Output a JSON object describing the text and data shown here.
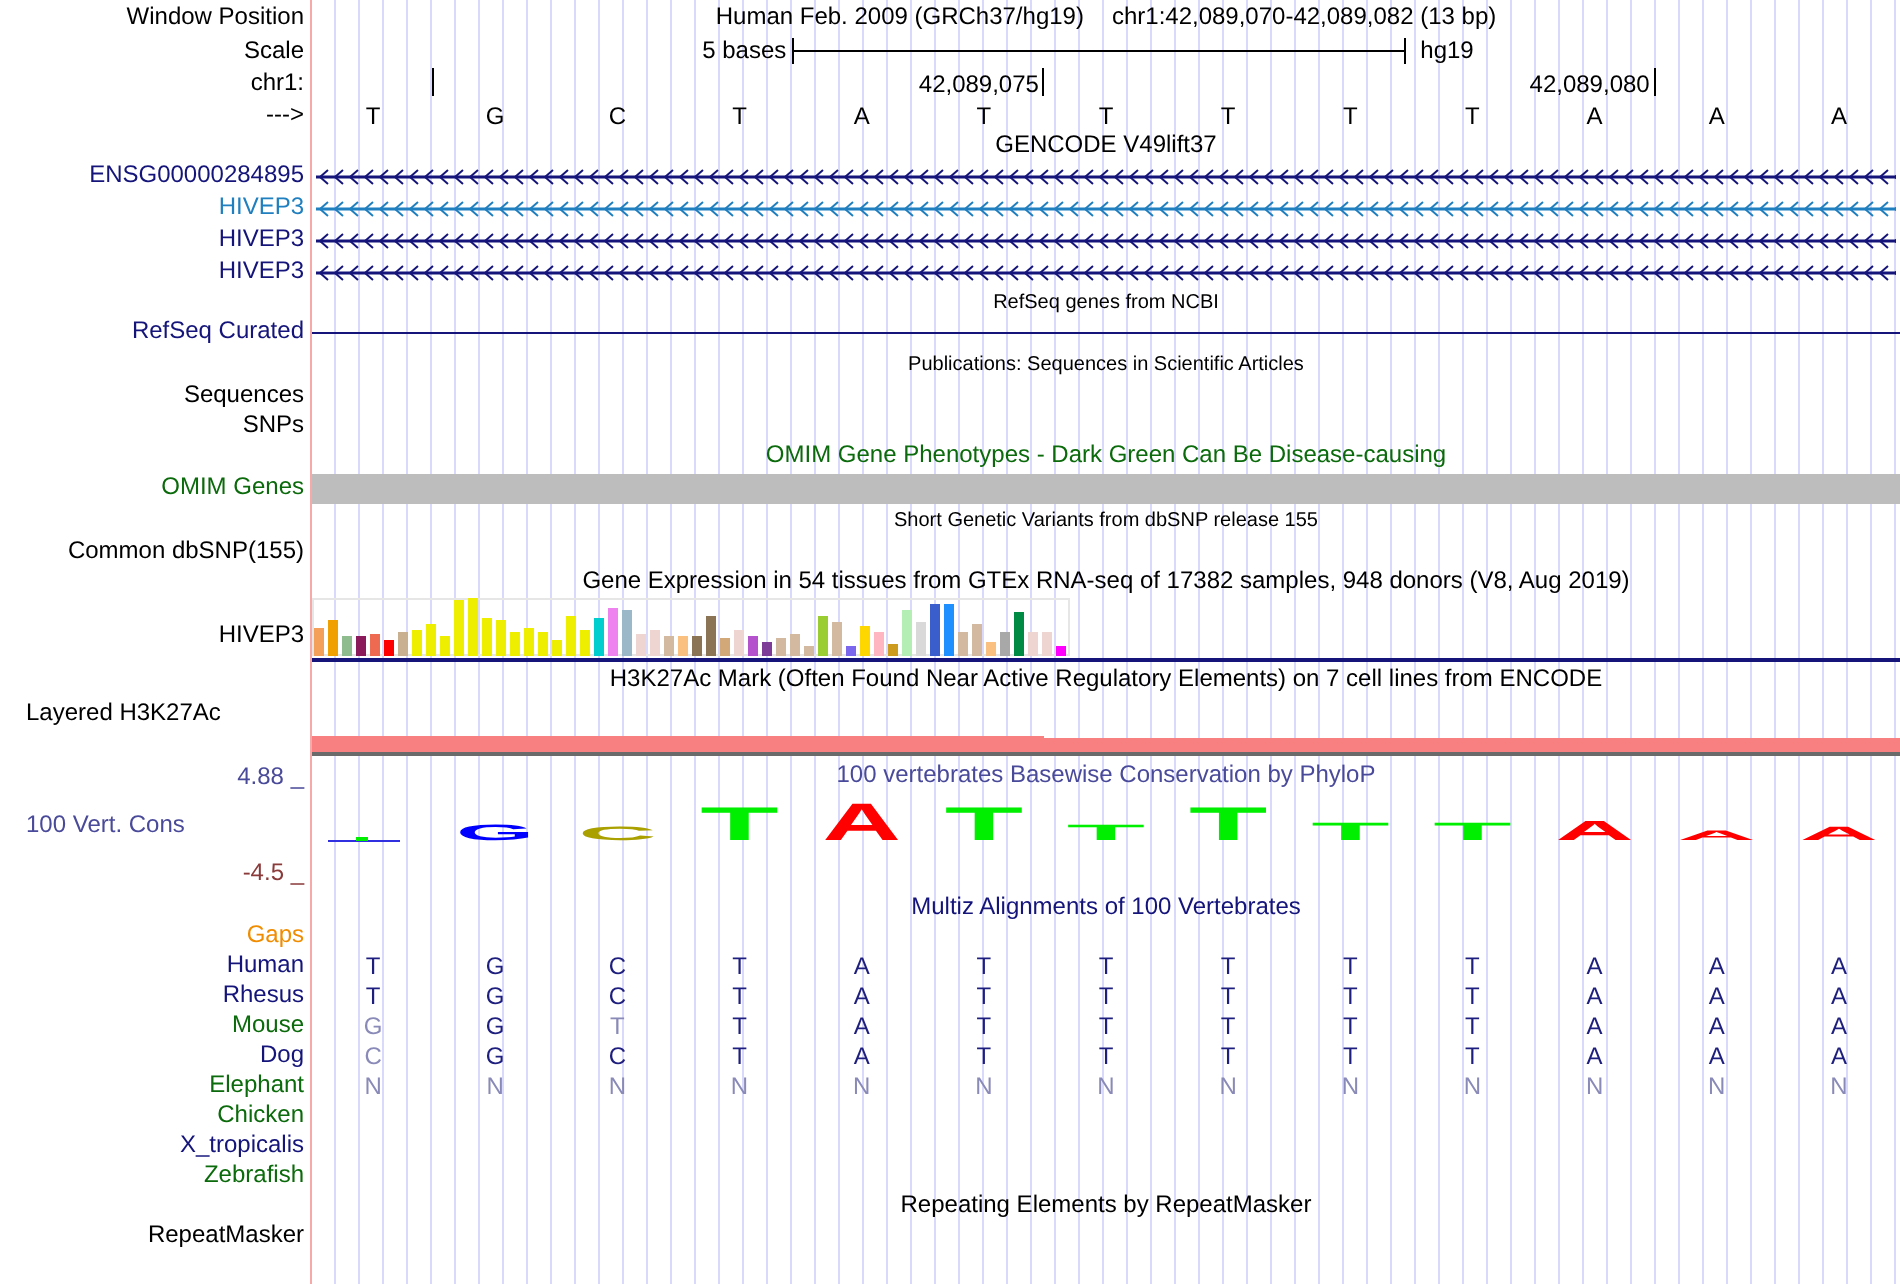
{
  "header": {
    "label": "Window Position",
    "title": "Human Feb. 2009 (GRCh37/hg19)",
    "position": "chr1:42,089,070-42,089,082 (13 bp)"
  },
  "scale": {
    "label": "Scale",
    "length": "5 bases",
    "assembly": "hg19"
  },
  "ruler": {
    "label": "chr1:",
    "strand_label": "--->",
    "bases": [
      {
        "base": "T",
        "tick": true
      },
      {
        "base": "G",
        "tick": false
      },
      {
        "base": "C",
        "tick": false
      },
      {
        "base": "T",
        "tick": false
      },
      {
        "base": "A",
        "tick": false
      },
      {
        "base": "T",
        "tick": true,
        "tick_label": "42,089,075"
      },
      {
        "base": "T",
        "tick": false
      },
      {
        "base": "T",
        "tick": false
      },
      {
        "base": "T",
        "tick": false
      },
      {
        "base": "T",
        "tick": false
      },
      {
        "base": "A",
        "tick": true,
        "tick_label": "42,089,080"
      },
      {
        "base": "A",
        "tick": false
      },
      {
        "base": "A",
        "tick": false
      }
    ]
  },
  "gencode": {
    "title": "GENCODE V49lift37",
    "genes": [
      {
        "name": "ENSG00000284895",
        "color": "#14147a"
      },
      {
        "name": "HIVEP3",
        "color": "#1f7fbf"
      },
      {
        "name": "HIVEP3",
        "color": "#14147a"
      },
      {
        "name": "HIVEP3",
        "color": "#14147a"
      }
    ]
  },
  "refseq": {
    "title": "RefSeq genes from NCBI",
    "label": "RefSeq Curated"
  },
  "publications": {
    "title": "Publications: Sequences in Scientific Articles",
    "labels": [
      "Sequences",
      "SNPs"
    ]
  },
  "omim": {
    "title": "OMIM Gene Phenotypes - Dark Green Can Be Disease-causing",
    "label": "OMIM Genes"
  },
  "dbsnp": {
    "title": "Short Genetic Variants from dbSNP release 155",
    "label": "Common dbSNP(155)"
  },
  "gtex": {
    "title": "Gene Expression in 54 tissues from GTEx RNA-seq of 17382 samples, 948 donors (V8, Aug 2019)",
    "label": "HIVEP3"
  },
  "h3k27ac": {
    "title": "H3K27Ac Mark (Often Found Near Active Regulatory Elements) on 7 cell lines from ENCODE",
    "label": "Layered H3K27Ac"
  },
  "conservation": {
    "title": "100 vertebrates Basewise Conservation by PhyloP",
    "label": "100 Vert. Cons",
    "max": "4.88 _",
    "min": "-4.5 _",
    "logo": [
      {
        "base": "G",
        "color": "#0000ff"
      },
      {
        "base": "C",
        "color": "#aaa000"
      },
      {
        "base": "T",
        "color": "#00ee00"
      },
      {
        "base": "A",
        "color": "#ff0000"
      },
      {
        "base": "T",
        "color": "#00ee00"
      },
      {
        "base": "T",
        "color": "#00ee00"
      },
      {
        "base": "T",
        "color": "#00ee00"
      },
      {
        "base": "T",
        "color": "#00ee00"
      },
      {
        "base": "T",
        "color": "#00ee00"
      },
      {
        "base": "A",
        "color": "#ff0000"
      },
      {
        "base": "A",
        "color": "#ff0000"
      },
      {
        "base": "A",
        "color": "#ff0000"
      }
    ]
  },
  "multiz": {
    "title": "Multiz Alignments of 100 Vertebrates",
    "gaps_label": "Gaps",
    "species": [
      {
        "name": "Human",
        "color": "#14147a",
        "bases": [
          {
            "base": "T",
            "dim": false
          },
          {
            "base": "G",
            "dim": false
          },
          {
            "base": "C",
            "dim": false
          },
          {
            "base": "T",
            "dim": false
          },
          {
            "base": "A",
            "dim": false
          },
          {
            "base": "T",
            "dim": false
          },
          {
            "base": "T",
            "dim": false
          },
          {
            "base": "T",
            "dim": false
          },
          {
            "base": "T",
            "dim": false
          },
          {
            "base": "T",
            "dim": false
          },
          {
            "base": "A",
            "dim": false
          },
          {
            "base": "A",
            "dim": false
          },
          {
            "base": "A",
            "dim": false
          }
        ]
      },
      {
        "name": "Rhesus",
        "color": "#14147a",
        "bases": [
          {
            "base": "T",
            "dim": false
          },
          {
            "base": "G",
            "dim": false
          },
          {
            "base": "C",
            "dim": false
          },
          {
            "base": "T",
            "dim": false
          },
          {
            "base": "A",
            "dim": false
          },
          {
            "base": "T",
            "dim": false
          },
          {
            "base": "T",
            "dim": false
          },
          {
            "base": "T",
            "dim": false
          },
          {
            "base": "T",
            "dim": false
          },
          {
            "base": "T",
            "dim": false
          },
          {
            "base": "A",
            "dim": false
          },
          {
            "base": "A",
            "dim": false
          },
          {
            "base": "A",
            "dim": false
          }
        ]
      },
      {
        "name": "Mouse",
        "color": "#0b6a0b",
        "bases": [
          {
            "base": "G",
            "dim": true
          },
          {
            "base": "G",
            "dim": false
          },
          {
            "base": "T",
            "dim": true
          },
          {
            "base": "T",
            "dim": false
          },
          {
            "base": "A",
            "dim": false
          },
          {
            "base": "T",
            "dim": false
          },
          {
            "base": "T",
            "dim": false
          },
          {
            "base": "T",
            "dim": false
          },
          {
            "base": "T",
            "dim": false
          },
          {
            "base": "T",
            "dim": false
          },
          {
            "base": "A",
            "dim": false
          },
          {
            "base": "A",
            "dim": false
          },
          {
            "base": "A",
            "dim": false
          }
        ]
      },
      {
        "name": "Dog",
        "color": "#14147a",
        "bases": [
          {
            "base": "C",
            "dim": true
          },
          {
            "base": "G",
            "dim": false
          },
          {
            "base": "C",
            "dim": false
          },
          {
            "base": "T",
            "dim": false
          },
          {
            "base": "A",
            "dim": false
          },
          {
            "base": "T",
            "dim": false
          },
          {
            "base": "T",
            "dim": false
          },
          {
            "base": "T",
            "dim": false
          },
          {
            "base": "T",
            "dim": false
          },
          {
            "base": "T",
            "dim": false
          },
          {
            "base": "A",
            "dim": false
          },
          {
            "base": "A",
            "dim": false
          },
          {
            "base": "A",
            "dim": false
          }
        ]
      },
      {
        "name": "Elephant",
        "color": "#0b6a0b",
        "bases": [
          {
            "base": "N",
            "dim": true
          },
          {
            "base": "N",
            "dim": true
          },
          {
            "base": "N",
            "dim": true
          },
          {
            "base": "N",
            "dim": true
          },
          {
            "base": "N",
            "dim": true
          },
          {
            "base": "N",
            "dim": true
          },
          {
            "base": "N",
            "dim": true
          },
          {
            "base": "N",
            "dim": true
          },
          {
            "base": "N",
            "dim": true
          },
          {
            "base": "N",
            "dim": true
          },
          {
            "base": "N",
            "dim": true
          },
          {
            "base": "N",
            "dim": true
          },
          {
            "base": "N",
            "dim": true
          }
        ]
      },
      {
        "name": "Chicken",
        "color": "#0b6a0b"
      },
      {
        "name": "X_tropicalis",
        "color": "#14147a"
      },
      {
        "name": "Zebrafish",
        "color": "#0b6a0b"
      }
    ]
  },
  "repeatmasker": {
    "title": "Repeating Elements by RepeatMasker",
    "label": "RepeatMasker"
  }
}
